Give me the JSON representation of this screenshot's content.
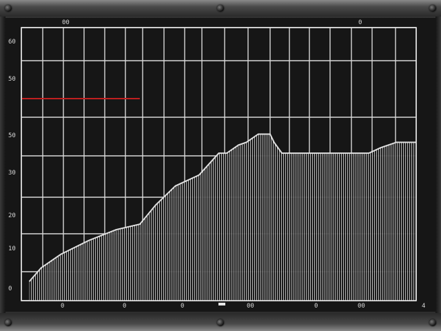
{
  "chart_data": {
    "type": "area",
    "title": "",
    "xlabel": "",
    "ylabel": "",
    "xlim": [
      0,
      100
    ],
    "ylim": [
      0,
      100
    ],
    "grid": true,
    "y_tick_labels": [
      "0",
      "10",
      "20",
      "30",
      "50",
      "50",
      "60"
    ],
    "x_tick_labels": [
      "0",
      "0",
      "0",
      "00",
      "0",
      "00",
      "4"
    ],
    "top_marks": [
      "00",
      "0"
    ],
    "series": [
      {
        "color": "#e0e0e0",
        "x": [
          2,
          5,
          10,
          17,
          24,
          30,
          34,
          39,
          45,
          50,
          52,
          55,
          57,
          60,
          63,
          64,
          66,
          75,
          88,
          91,
          95,
          100
        ],
        "y": [
          7,
          12,
          17,
          22,
          26,
          28,
          35,
          42,
          46,
          54,
          54,
          57,
          58,
          61,
          61,
          58,
          54,
          54,
          54,
          56,
          58,
          58
        ]
      }
    ],
    "reference_line": {
      "color": "#c02020",
      "x": [
        0,
        30
      ],
      "y": [
        74,
        74
      ]
    }
  },
  "colors": {
    "grid": "#d8d8d8",
    "fill": "#cfcfcf",
    "screen": "#161616"
  }
}
